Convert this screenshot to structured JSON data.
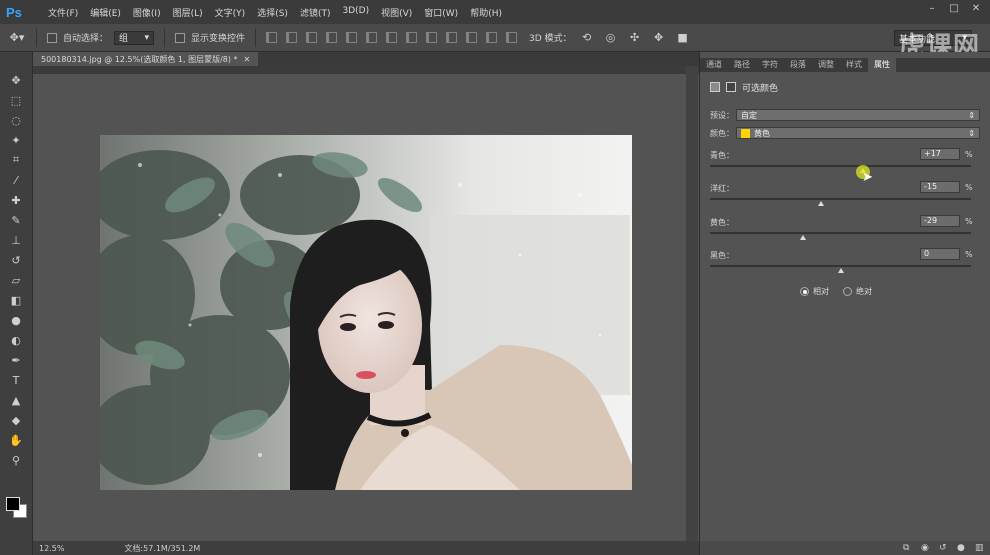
{
  "menubar": {
    "logo": "Ps",
    "items": [
      "文件(F)",
      "编辑(E)",
      "图像(I)",
      "图层(L)",
      "文字(Y)",
      "选择(S)",
      "滤镜(T)",
      "3D(D)",
      "视图(V)",
      "窗口(W)",
      "帮助(H)"
    ]
  },
  "options": {
    "auto_select_label": "自动选择：",
    "auto_select_value": "组",
    "show_transform_label": "显示变换控件",
    "mode3d_label": "3D 模式：",
    "workspace": "基本功能"
  },
  "watermark": "虎课网",
  "document": {
    "tab_title": "500180314.jpg @ 12.5%(选取颜色 1, 图层蒙版/8) *",
    "zoom": "12.5%",
    "doc_info": "文档:57.1M/351.2M"
  },
  "panel": {
    "tabs": [
      "通道",
      "路径",
      "字符",
      "段落",
      "调整",
      "样式",
      "属性"
    ],
    "title": "可选颜色",
    "preset_label": "预设：",
    "preset_value": "自定",
    "color_label": "颜色：",
    "color_value": "黄色",
    "sliders": [
      {
        "label": "青色：",
        "value": "+17",
        "pct": "%",
        "fraction": 0.585
      },
      {
        "label": "洋红：",
        "value": "-15",
        "pct": "%",
        "fraction": 0.425
      },
      {
        "label": "黄色：",
        "value": "-29",
        "pct": "%",
        "fraction": 0.355
      },
      {
        "label": "黑色：",
        "value": "0",
        "pct": "%",
        "fraction": 0.5
      }
    ],
    "relative_label": "相对",
    "absolute_label": "绝对"
  },
  "colors": {
    "swatch_yellow": "#ffd400",
    "cursor_highlight": "#dce61e"
  }
}
